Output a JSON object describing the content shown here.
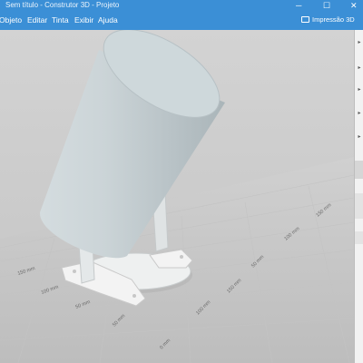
{
  "window": {
    "title": "Sem título - Construtor 3D - Projeto"
  },
  "menu": {
    "items": [
      "Objeto",
      "Editar",
      "Tinta",
      "Exibir",
      "Ajuda"
    ]
  },
  "toolbar": {
    "print3d_label": "Impressão 3D",
    "print_icon": "printer-icon"
  },
  "viewport": {
    "axis_labels": {
      "x_axis": [
        "50 mm",
        "100 mm",
        "150 mm"
      ],
      "y_axis": [
        "0 mm",
        "50 mm",
        "100 mm",
        "150 mm"
      ],
      "z_axis": [
        "50 mm",
        "100 mm",
        "150 mm"
      ]
    }
  },
  "colors": {
    "accent": "#3b8fd6",
    "model": "#c8d2d5",
    "grid": "#c8c8c8",
    "sidebar": "#f2f2f2"
  }
}
